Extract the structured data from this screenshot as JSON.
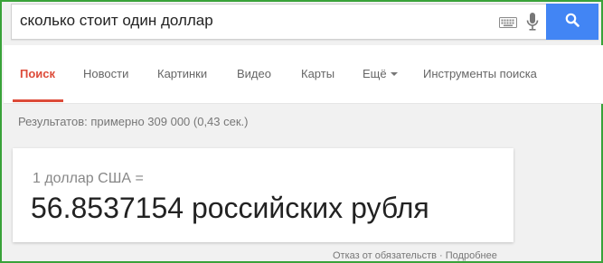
{
  "search": {
    "query": "сколько стоит один доллар"
  },
  "tabs": [
    {
      "label": "Поиск"
    },
    {
      "label": "Новости"
    },
    {
      "label": "Картинки"
    },
    {
      "label": "Видео"
    },
    {
      "label": "Карты"
    },
    {
      "label": "Ещё"
    },
    {
      "label": "Инструменты поиска"
    }
  ],
  "result_stats": "Результатов: примерно 309 000 (0,43 сек.)",
  "converter": {
    "from": "1 доллар США =",
    "result": "56.8537154 российских рубля"
  },
  "footer": {
    "disclaimer": "Отказ от обязательств",
    "separator": "·",
    "more": "Подробнее"
  },
  "colors": {
    "accent": "#dd4b39",
    "search_button": "#4285f4",
    "frame_border": "#3aa33a"
  },
  "icons": {
    "keyboard": "keyboard-icon",
    "microphone": "microphone-icon",
    "search": "search-icon"
  }
}
